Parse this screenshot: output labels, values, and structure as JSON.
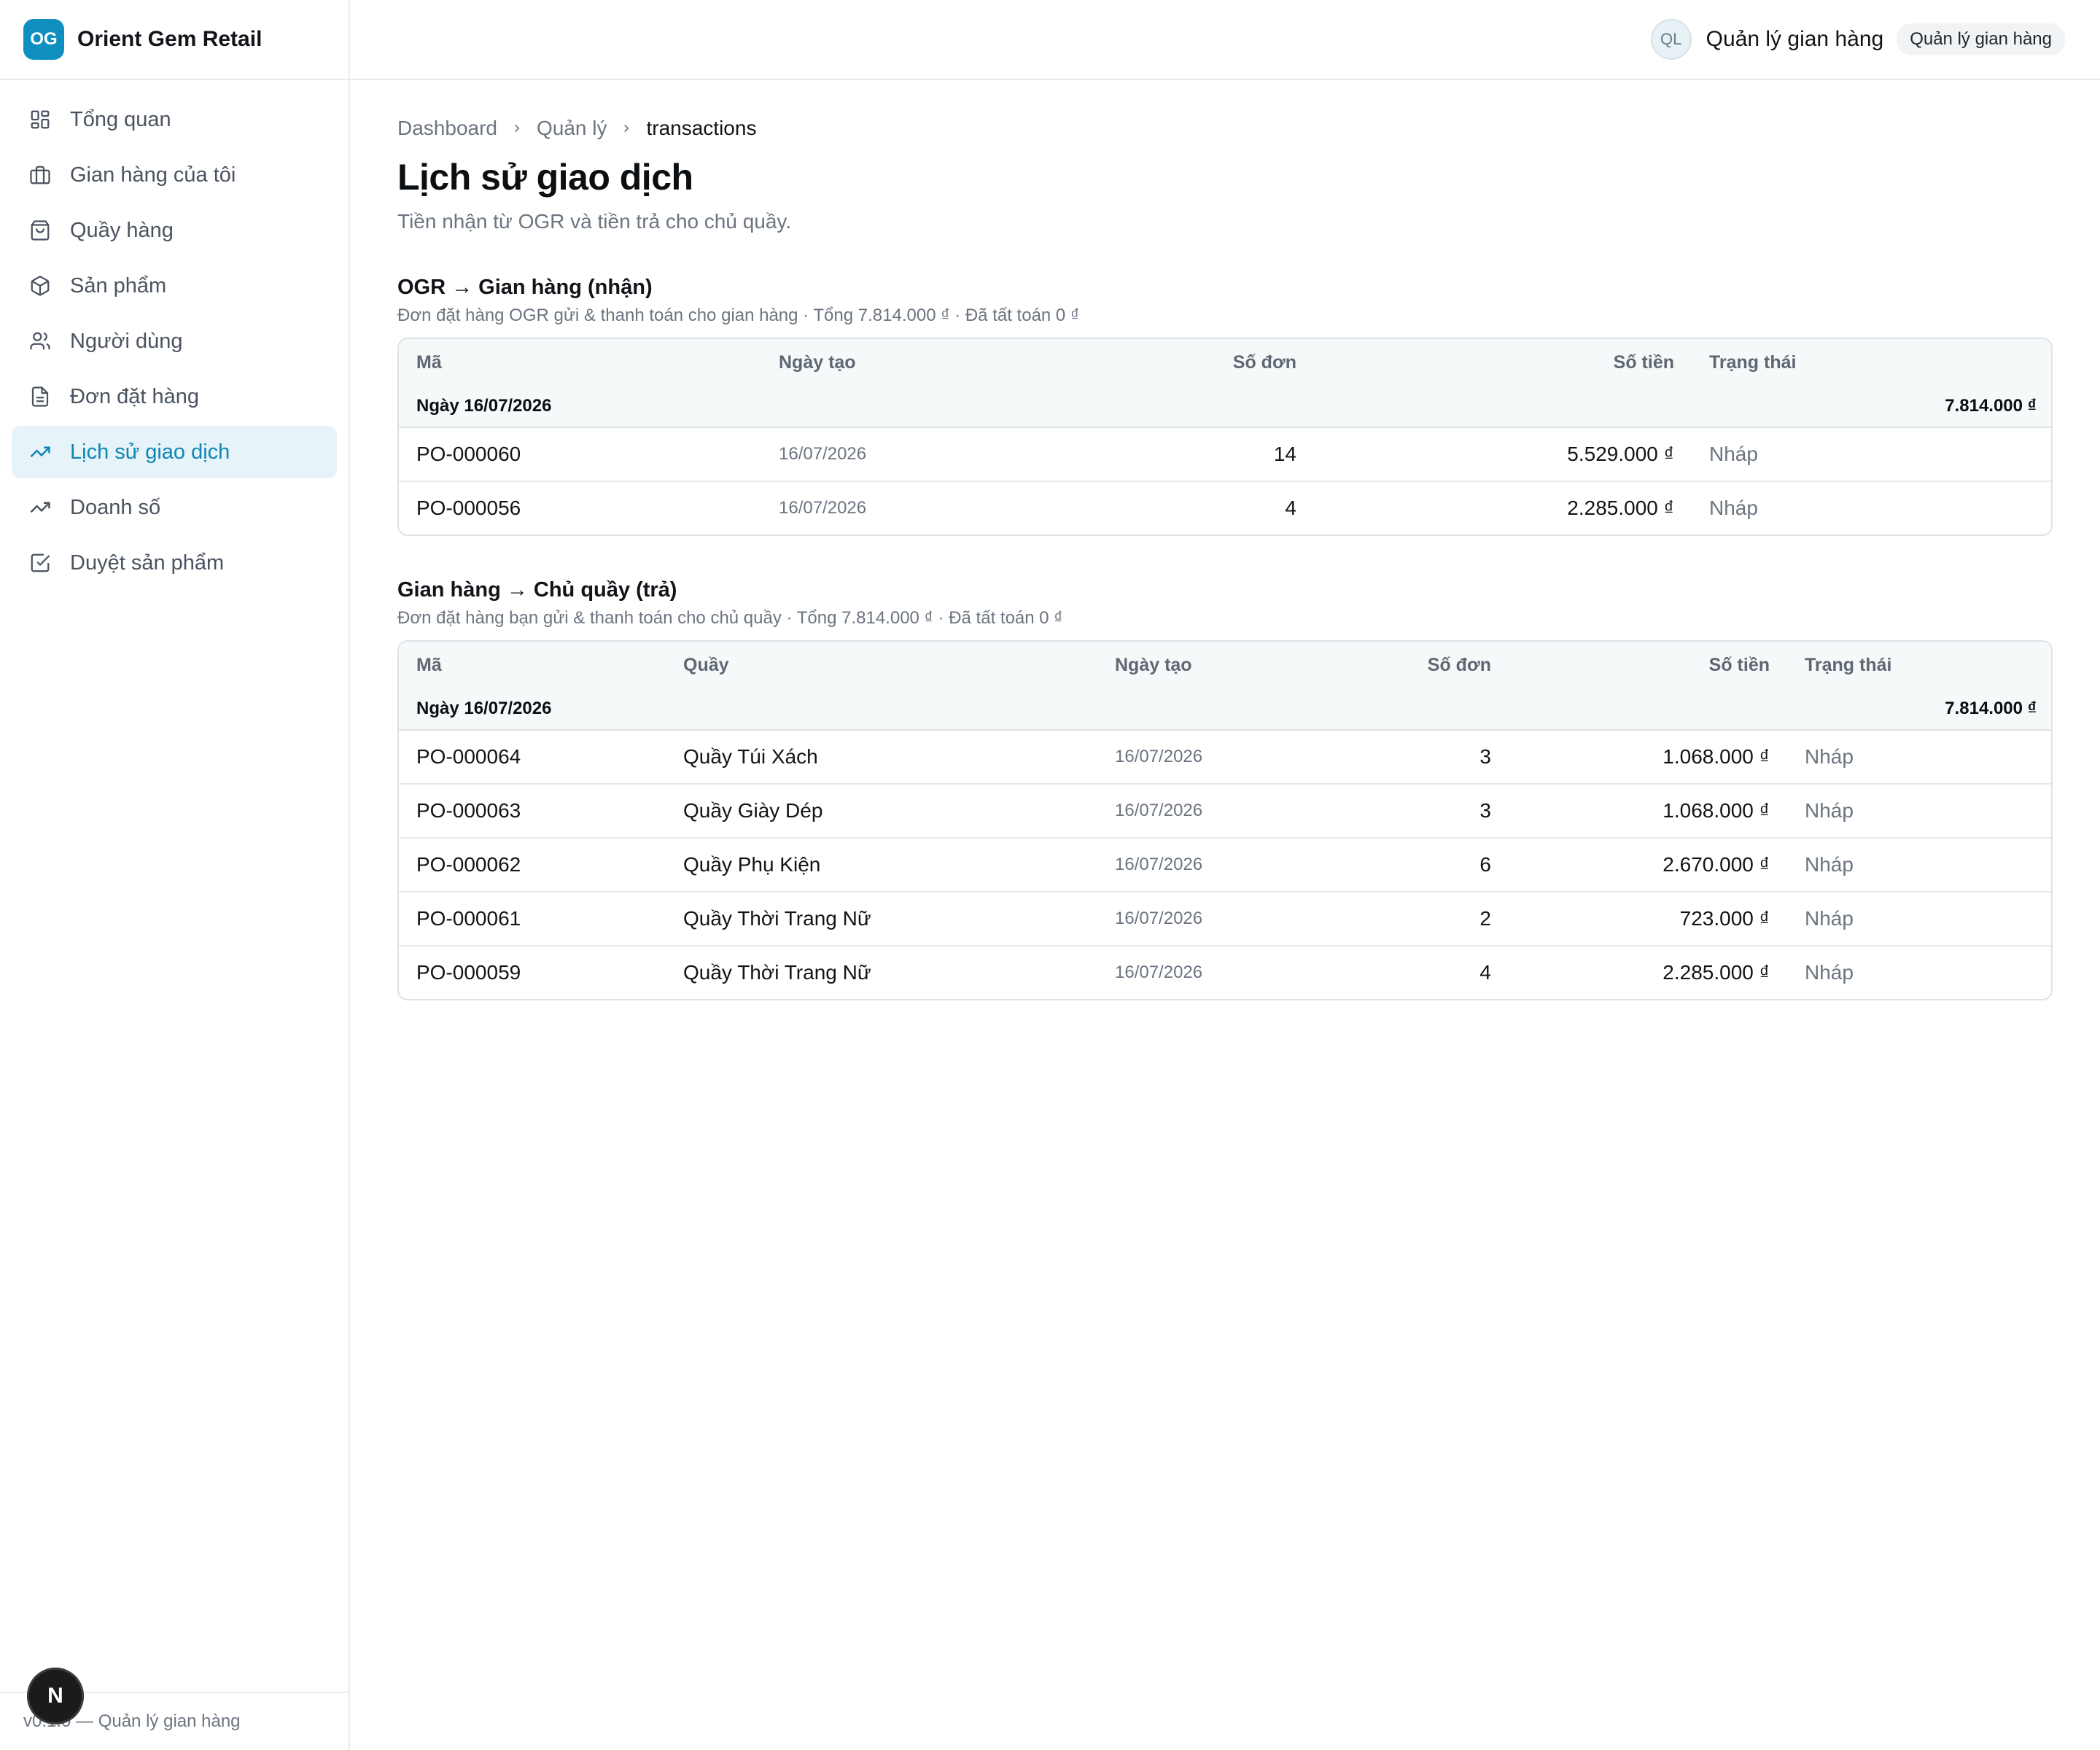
{
  "brand": {
    "logo_text": "OG",
    "name": "Orient Gem Retail"
  },
  "sidebar": {
    "items": [
      {
        "label": "Tổng quan",
        "icon": "dashboard-grid-icon"
      },
      {
        "label": "Gian hàng của tôi",
        "icon": "briefcase-icon"
      },
      {
        "label": "Quầy hàng",
        "icon": "shopping-bag-icon"
      },
      {
        "label": "Sản phẩm",
        "icon": "package-icon"
      },
      {
        "label": "Người dùng",
        "icon": "users-icon"
      },
      {
        "label": "Đơn đặt hàng",
        "icon": "file-text-icon"
      },
      {
        "label": "Lịch sử giao dịch",
        "icon": "trending-up-icon",
        "active": true
      },
      {
        "label": "Doanh số",
        "icon": "trending-up-icon"
      },
      {
        "label": "Duyệt sản phẩm",
        "icon": "check-square-icon"
      }
    ],
    "footer": "v0.1.0 — Quản lý gian hàng",
    "n_badge": "N"
  },
  "header": {
    "avatar_initials": "QL",
    "user_name": "Quản lý gian hàng",
    "role_chip": "Quản lý gian hàng"
  },
  "breadcrumb": [
    "Dashboard",
    "Quản lý",
    "transactions"
  ],
  "page": {
    "title": "Lịch sử giao dịch",
    "subtitle": "Tiền nhận từ OGR và tiền trả cho chủ quầy."
  },
  "section1": {
    "title": "OGR → Gian hàng (nhận)",
    "subtitle": "Đơn đặt hàng OGR gửi & thanh toán cho gian hàng · Tổng 7.814.000 ₫ · Đã tất toán 0 ₫",
    "columns": [
      "Mã",
      "Ngày tạo",
      "Số đơn",
      "Số tiền",
      "Trạng thái"
    ],
    "group": {
      "label": "Ngày 16/07/2026",
      "total": "7.814.000 ₫"
    },
    "rows": [
      {
        "code": "PO-000060",
        "date": "16/07/2026",
        "count": "14",
        "amount": "5.529.000 ₫",
        "status": "Nháp"
      },
      {
        "code": "PO-000056",
        "date": "16/07/2026",
        "count": "4",
        "amount": "2.285.000 ₫",
        "status": "Nháp"
      }
    ]
  },
  "section2": {
    "title": "Gian hàng → Chủ quầy (trả)",
    "subtitle": "Đơn đặt hàng bạn gửi & thanh toán cho chủ quầy · Tổng 7.814.000 ₫ · Đã tất toán 0 ₫",
    "columns": [
      "Mã",
      "Quầy",
      "Ngày tạo",
      "Số đơn",
      "Số tiền",
      "Trạng thái"
    ],
    "group": {
      "label": "Ngày 16/07/2026",
      "total": "7.814.000 ₫"
    },
    "rows": [
      {
        "code": "PO-000064",
        "counter": "Quầy Túi Xách",
        "date": "16/07/2026",
        "count": "3",
        "amount": "1.068.000 ₫",
        "status": "Nháp"
      },
      {
        "code": "PO-000063",
        "counter": "Quầy Giày Dép",
        "date": "16/07/2026",
        "count": "3",
        "amount": "1.068.000 ₫",
        "status": "Nháp"
      },
      {
        "code": "PO-000062",
        "counter": "Quầy Phụ Kiện",
        "date": "16/07/2026",
        "count": "6",
        "amount": "2.670.000 ₫",
        "status": "Nháp"
      },
      {
        "code": "PO-000061",
        "counter": "Quầy Thời Trang Nữ",
        "date": "16/07/2026",
        "count": "2",
        "amount": "723.000 ₫",
        "status": "Nháp"
      },
      {
        "code": "PO-000059",
        "counter": "Quầy Thời Trang Nữ",
        "date": "16/07/2026",
        "count": "4",
        "amount": "2.285.000 ₫",
        "status": "Nháp"
      }
    ]
  },
  "colors": {
    "accent": "#0e8fc0",
    "active_bg": "#e6f4fa",
    "active_text": "#0e86b6",
    "border": "#dde2e7",
    "muted": "#6b7480"
  }
}
